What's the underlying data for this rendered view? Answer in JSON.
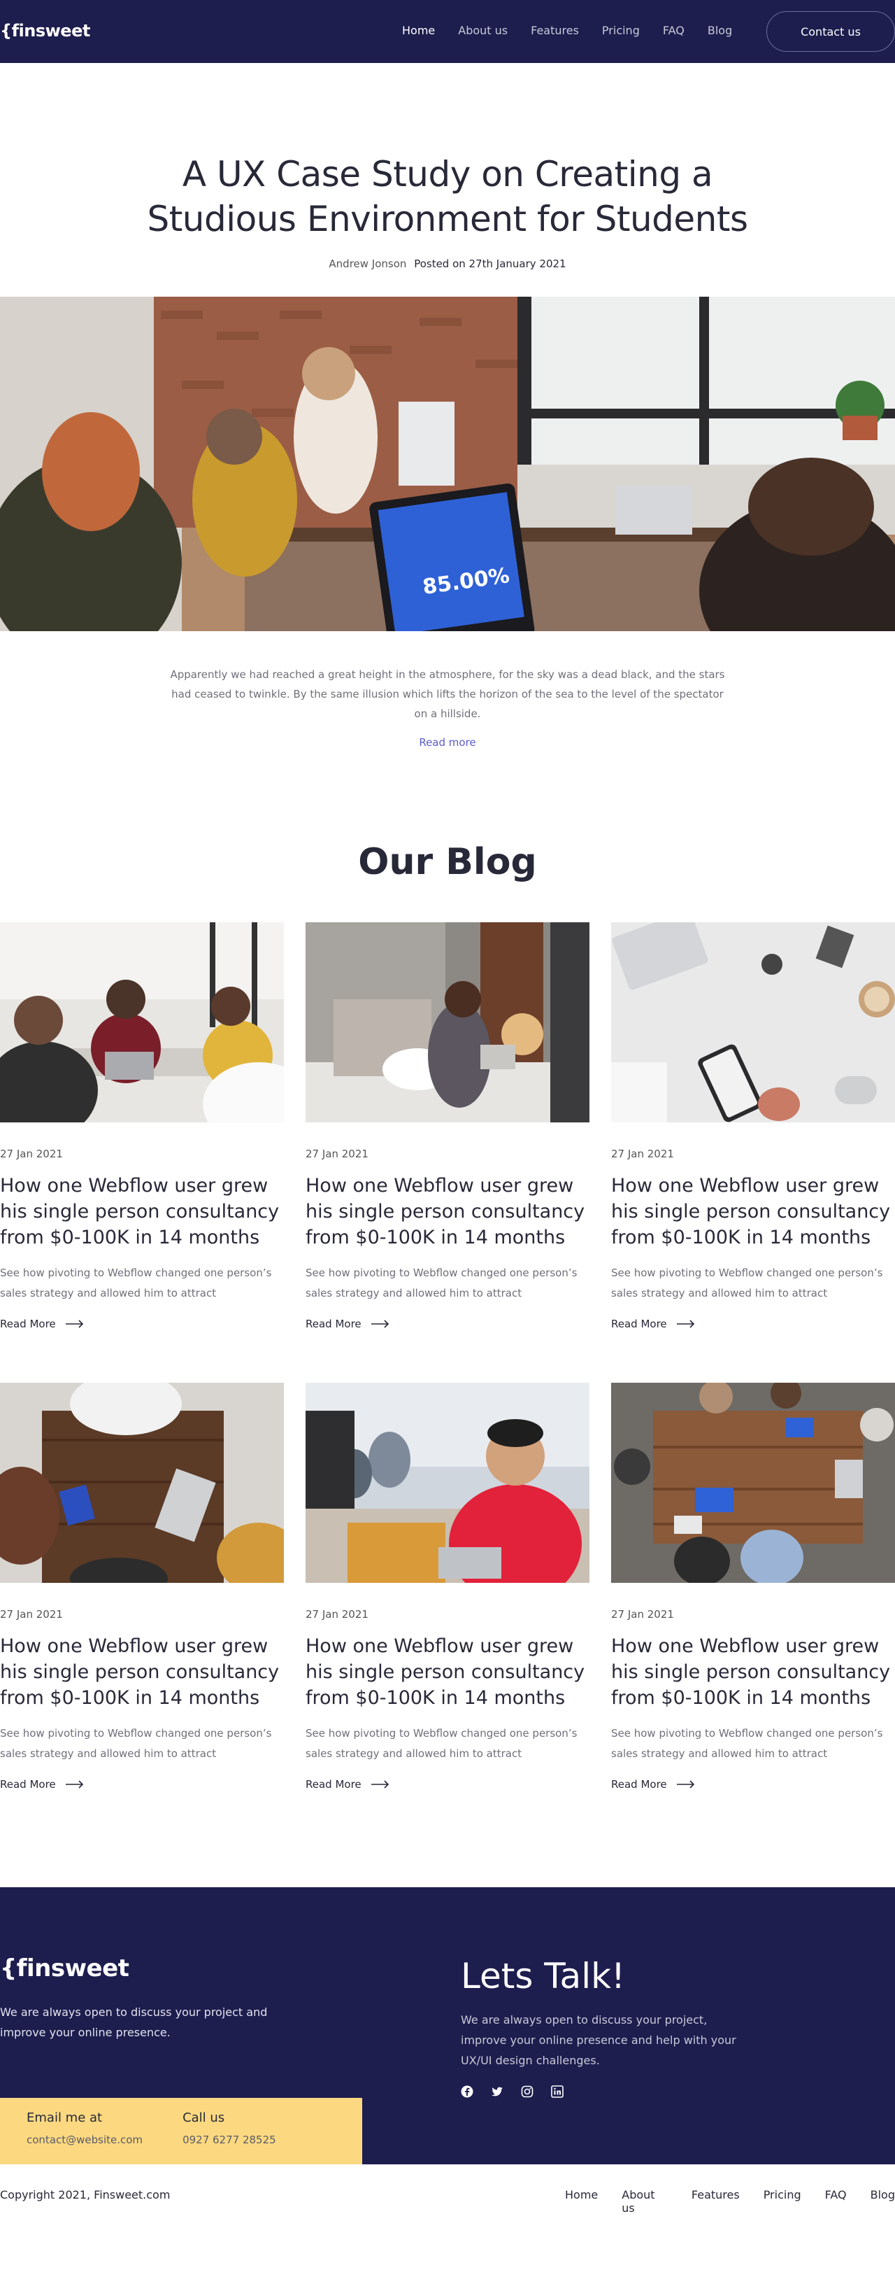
{
  "header": {
    "logo": "{finsweet",
    "nav": [
      "Home",
      "About us",
      "Features",
      "Pricing",
      "FAQ",
      "Blog"
    ],
    "contact_label": "Contact us"
  },
  "hero": {
    "title_line1": "A UX Case Study on Creating a",
    "title_line2": "Studious Environment for Students",
    "author": "Andrew Jonson",
    "posted": "Posted on 27th January 2021",
    "paragraph": "Apparently we had reached a great height in the atmosphere, for the sky was a dead black, and the stars had ceased to twinkle. By the same illusion which lifts the horizon of the sea to the level of the spectator on a hillside.",
    "read_more": "Read more",
    "screen_text": "85.00%"
  },
  "blog": {
    "title": "Our Blog",
    "posts": [
      {
        "date": "27 Jan 2021",
        "title": "How one Webflow user grew his single person consultancy from $0-100K in 14 months",
        "desc": "See how pivoting to Webflow changed one person’s sales strategy and allowed him to attract",
        "read": "Read More"
      },
      {
        "date": "27 Jan 2021",
        "title": "How one Webflow user grew his single person consultancy from $0-100K in 14 months",
        "desc": "See how pivoting to Webflow changed one person’s sales strategy and allowed him to attract",
        "read": "Read More"
      },
      {
        "date": "27 Jan 2021",
        "title": "How one Webflow user grew his single person consultancy from $0-100K in 14 months",
        "desc": "See how pivoting to Webflow changed one person’s sales strategy and allowed him to attract",
        "read": "Read More"
      },
      {
        "date": "27 Jan 2021",
        "title": "How one Webflow user grew his single person consultancy from $0-100K in 14 months",
        "desc": "See how pivoting to Webflow changed one person’s sales strategy and allowed him to attract",
        "read": "Read More"
      },
      {
        "date": "27 Jan 2021",
        "title": "How one Webflow user grew his single person consultancy from $0-100K in 14 months",
        "desc": "See how pivoting to Webflow changed one person’s sales strategy and allowed him to attract",
        "read": "Read More"
      },
      {
        "date": "27 Jan 2021",
        "title": "How one Webflow user grew his single person consultancy from $0-100K in 14 months",
        "desc": "See how pivoting to Webflow changed one person’s sales strategy and allowed him to attract",
        "read": "Read More"
      }
    ]
  },
  "footer": {
    "logo": "{finsweet",
    "desc": "We are always open to discuss your project and improve your online presence.",
    "email_label": "Email me at",
    "email_value": "contact@website.com",
    "call_label": "Call us",
    "call_value": "0927 6277 28525",
    "talk_title": "Lets Talk!",
    "talk_desc": "We are always open to discuss your project, improve your online presence and help with your UX/UI design challenges.",
    "socials": [
      "facebook-icon",
      "twitter-icon",
      "instagram-icon",
      "linkedin-icon"
    ]
  },
  "bottom": {
    "copyright": "Copyright 2021, Finsweet.com",
    "nav": [
      "Home",
      "About us",
      "Features",
      "Pricing",
      "FAQ",
      "Blog"
    ]
  },
  "colors": {
    "navy": "#1d1d4e",
    "yellow": "#fcd980",
    "link_purple": "#5b5bc9",
    "dark_text": "#282938"
  }
}
